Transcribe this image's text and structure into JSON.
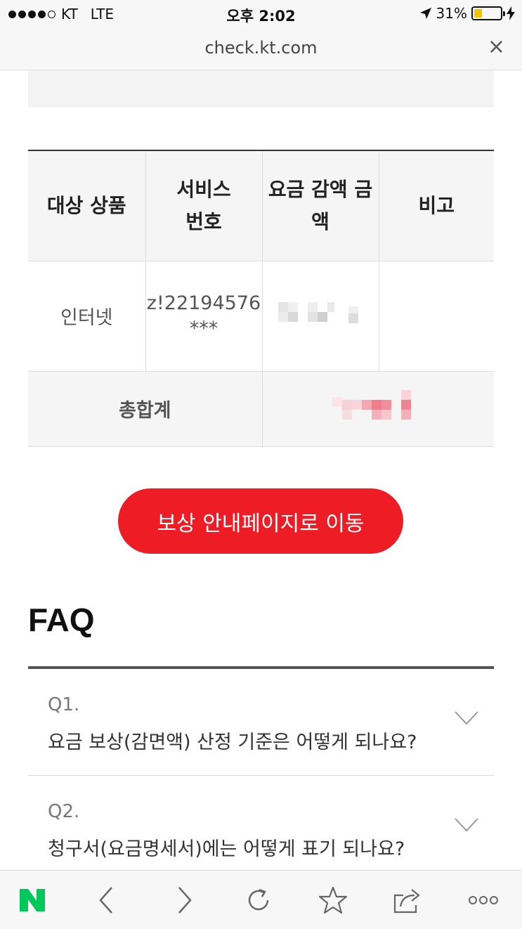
{
  "status_bar": {
    "carrier": "KT",
    "network": "LTE",
    "time": "오후 2:02",
    "battery": "31%",
    "battery_level": 0.31
  },
  "url_bar": {
    "url": "check.kt.com",
    "close_label": "×"
  },
  "table": {
    "headers": [
      "대상 상품",
      "서비스\n번호",
      "요금 감액 금\n액",
      "비고"
    ],
    "rows": [
      {
        "product": "인터넷",
        "service_number": "z!22194576",
        "service_number_mask": "***",
        "amount": "",
        "note": ""
      }
    ],
    "total_label": "총합계",
    "total_amount": ""
  },
  "button": {
    "label": "보상 안내페이지로 이동",
    "color": "#ee1c25"
  },
  "faq": {
    "title": "FAQ",
    "items": [
      {
        "q": "Q1.",
        "text": "요금 보상(감면액) 산정 기준은 어떻게 되나요?"
      },
      {
        "q": "Q2.",
        "text": "청구서(요금명세서)에는 어떻게 표기 되나요?"
      }
    ]
  },
  "toolbar": {
    "items": [
      "naver-logo",
      "back",
      "forward",
      "reload",
      "bookmark",
      "share",
      "more"
    ],
    "naver_logo_text": "N",
    "naver_color": "#03c75a"
  }
}
